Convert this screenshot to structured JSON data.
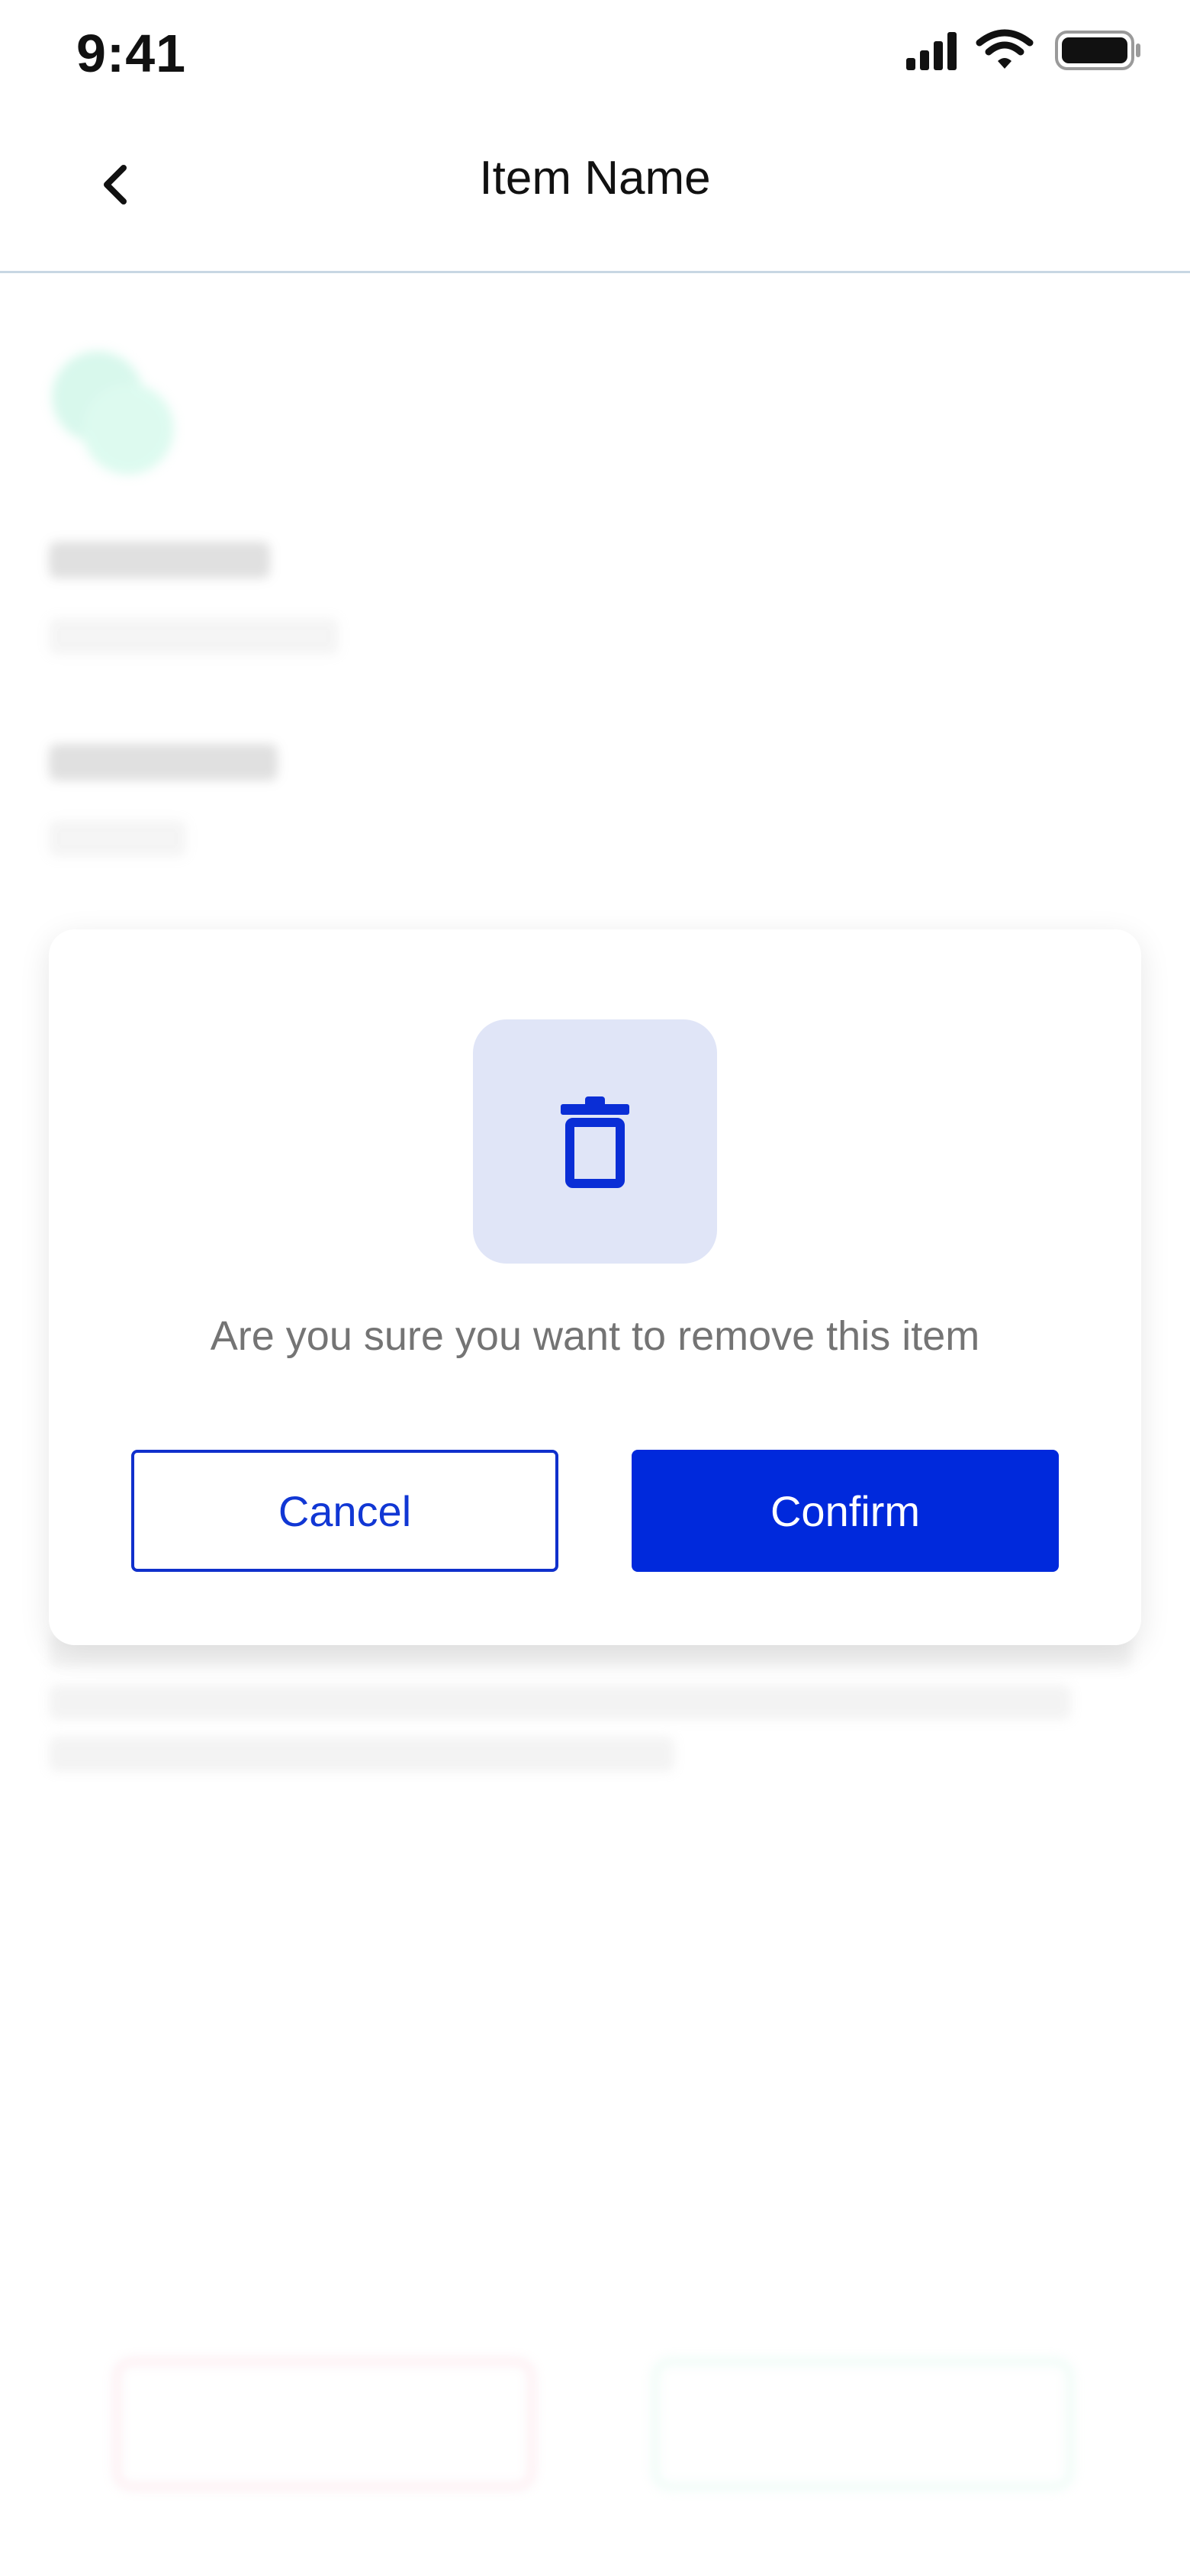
{
  "status_bar": {
    "time": "9:41",
    "icons": [
      "cellular-signal-icon",
      "wifi-icon",
      "battery-icon"
    ]
  },
  "header": {
    "title": "Item Name",
    "back_icon": "chevron-left-icon"
  },
  "modal": {
    "icon": "trash-icon",
    "message": "Are you sure you want to remove this item",
    "cancel_label": "Cancel",
    "confirm_label": "Confirm"
  },
  "colors": {
    "primary": "#0029dc",
    "icon_bg": "#e0e5f7",
    "remove_accent": "#e84a76",
    "edit_accent": "#28cf8f"
  }
}
